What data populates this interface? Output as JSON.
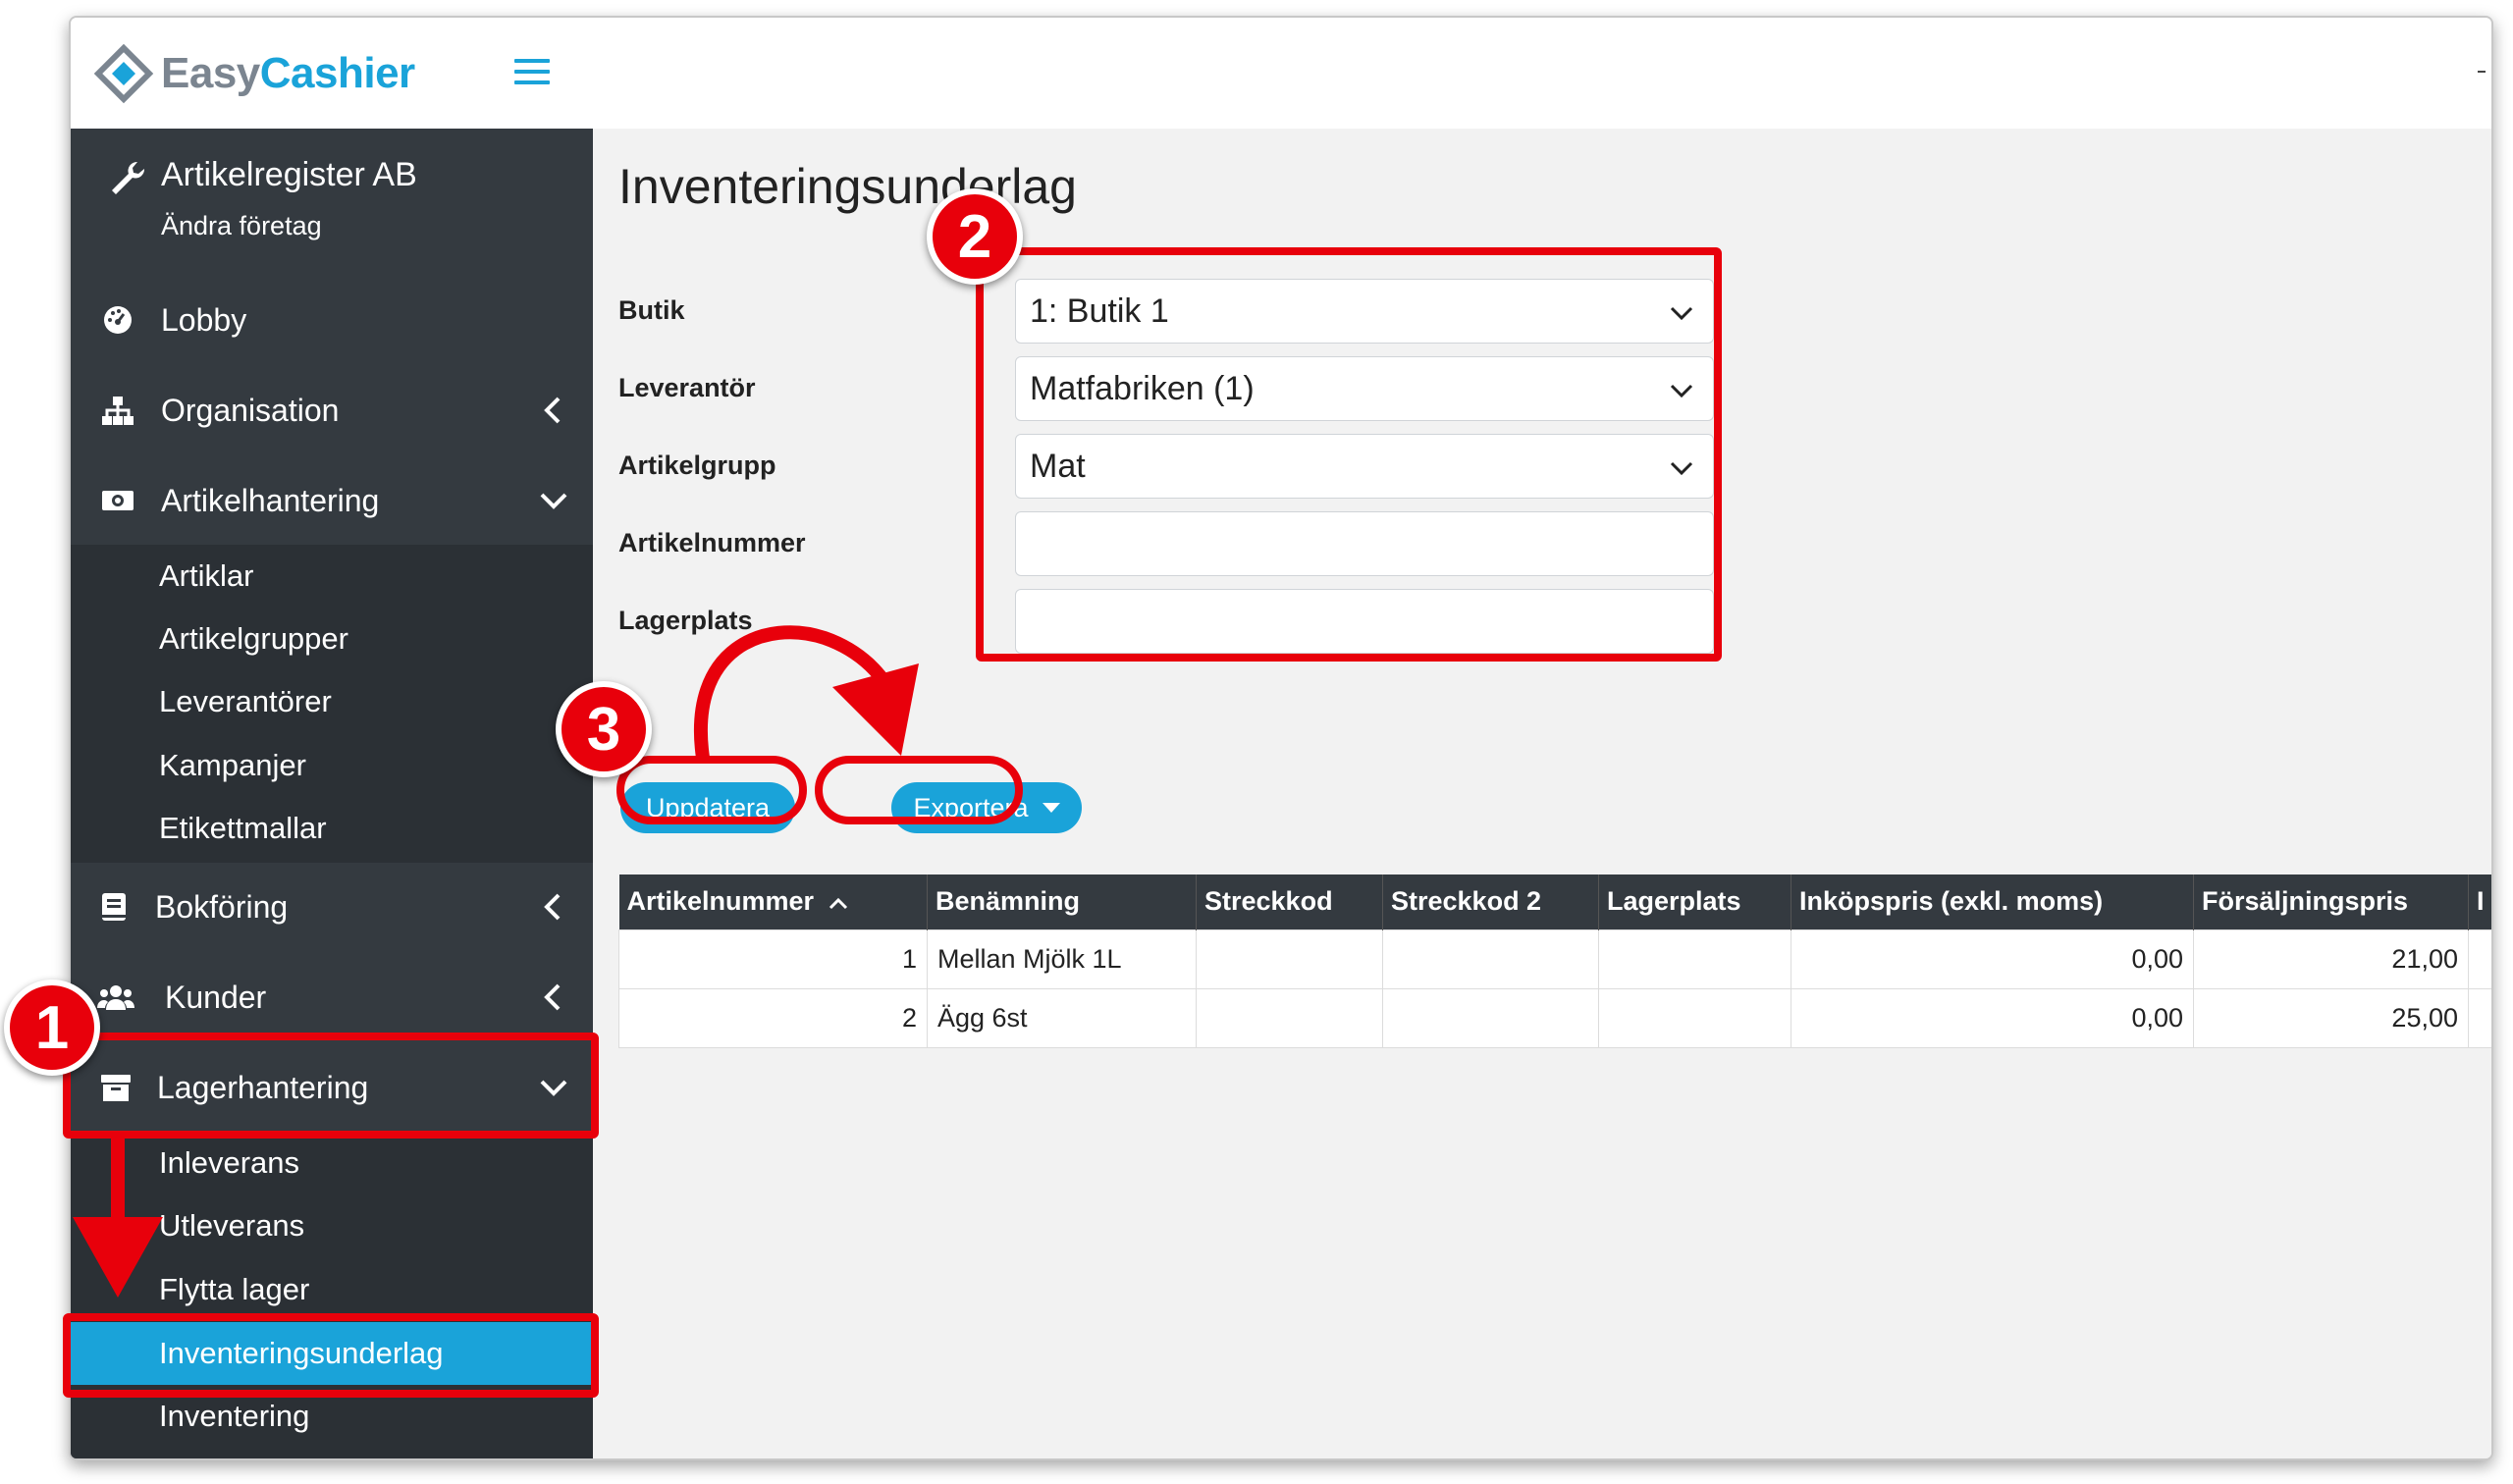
{
  "app": {
    "logo_easy": "Easy",
    "logo_cashier": "Cashier"
  },
  "company": {
    "name": "Artikelregister AB",
    "change_label": "Ändra företag"
  },
  "sidebar": {
    "items": [
      {
        "label": "Lobby",
        "icon": "dashboard-icon"
      },
      {
        "label": "Organisation",
        "icon": "sitemap-icon",
        "expanded": false
      },
      {
        "label": "Artikelhantering",
        "icon": "money-icon",
        "expanded": true
      },
      {
        "label": "Bokföring",
        "icon": "book-icon",
        "expanded": false
      },
      {
        "label": "Kunder",
        "icon": "users-icon",
        "expanded": false
      },
      {
        "label": "Lagerhantering",
        "icon": "archive-icon",
        "expanded": true
      }
    ],
    "artikel_sub": [
      "Artiklar",
      "Artikelgrupper",
      "Leverantörer",
      "Kampanjer",
      "Etikettmallar"
    ],
    "lager_sub": [
      "Inleverans",
      "Utleverans",
      "Flytta lager",
      "Inventeringsunderlag",
      "Inventering"
    ],
    "active_sub": "Inventeringsunderlag"
  },
  "main": {
    "title": "Inventeringsunderlag",
    "form": {
      "butik_label": "Butik",
      "butik_value": "1: Butik 1",
      "leverantor_label": "Leverantör",
      "leverantor_value": "Matfabriken (1)",
      "artikelgrupp_label": "Artikelgrupp",
      "artikelgrupp_value": "Mat",
      "artikelnummer_label": "Artikelnummer",
      "artikelnummer_value": "",
      "lagerplats_label": "Lagerplats",
      "lagerplats_value": ""
    },
    "buttons": {
      "update": "Uppdatera",
      "export": "Exportera"
    },
    "table": {
      "headers": [
        "Artikelnummer",
        "Benämning",
        "Streckkod",
        "Streckkod 2",
        "Lagerplats",
        "Inköpspris (exkl. moms)",
        "Försäljningspris",
        "I"
      ],
      "sort_column": "Artikelnummer",
      "rows": [
        {
          "artikelnummer": "1",
          "benamning": "Mellan Mjölk 1L",
          "streckkod": "",
          "streckkod2": "",
          "lagerplats": "",
          "inkopspris": "0,00",
          "forsaljningspris": "21,00"
        },
        {
          "artikelnummer": "2",
          "benamning": "Ägg 6st",
          "streckkod": "",
          "streckkod2": "",
          "lagerplats": "",
          "inkopspris": "0,00",
          "forsaljningspris": "25,00"
        }
      ]
    }
  },
  "annotations": {
    "badge1": "1",
    "badge2": "2",
    "badge3": "3",
    "color": "#e8000b"
  },
  "colors": {
    "accent": "#1aa3d9",
    "sidebar": "#343a40",
    "sidebar_sub": "#2b3035"
  }
}
